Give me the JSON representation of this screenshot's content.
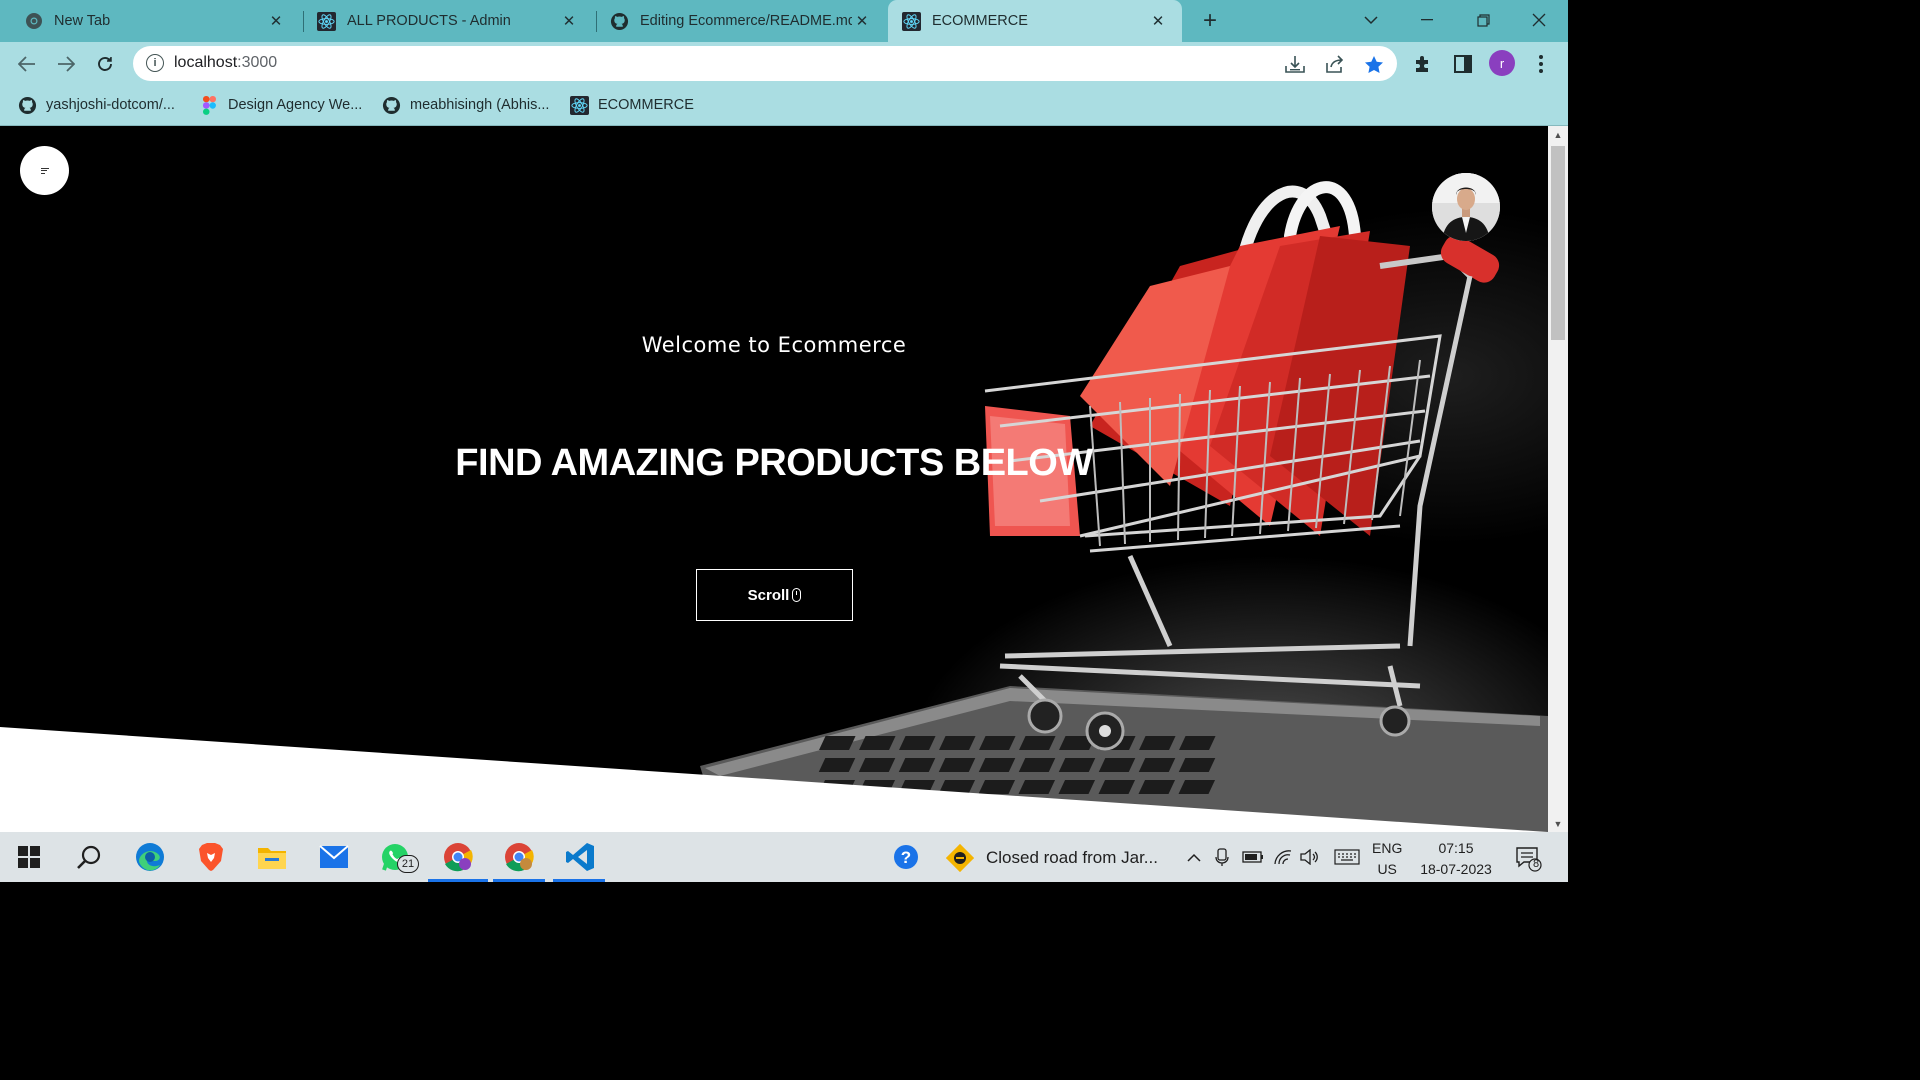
{
  "browser": {
    "tabs": [
      {
        "title": "New Tab",
        "icon": "chrome-icon",
        "active": false
      },
      {
        "title": "ALL PRODUCTS - Admin",
        "icon": "react-icon",
        "active": false
      },
      {
        "title": "Editing Ecommerce/README.md",
        "icon": "github-icon",
        "active": false
      },
      {
        "title": "ECOMMERCE",
        "icon": "react-icon",
        "active": true
      }
    ],
    "url_host": "localhost",
    "url_path": ":3000",
    "profile_initial": "r",
    "bookmarks": [
      {
        "label": "yashjoshi-dotcom/...",
        "icon": "github-icon"
      },
      {
        "label": "Design Agency We...",
        "icon": "figma-icon"
      },
      {
        "label": "meabhisingh (Abhis...",
        "icon": "github-icon"
      },
      {
        "label": "ECOMMERCE",
        "icon": "react-icon"
      }
    ]
  },
  "page": {
    "welcome": "Welcome to Ecommerce",
    "headline": "FIND AMAZING PRODUCTS BELOW",
    "scroll_label": "Scroll"
  },
  "taskbar": {
    "apps": [
      "windows-start-icon",
      "search-icon",
      "edge-icon",
      "brave-icon",
      "file-explorer-icon",
      "mail-icon",
      "whatsapp-icon",
      "chrome-profile-icon",
      "chrome-icon",
      "vscode-icon"
    ],
    "whatsapp_badge": "21",
    "weather_text": "Closed road from Jar...",
    "lang_top": "ENG",
    "lang_bottom": "US",
    "time": "07:15",
    "date": "18-07-2023",
    "notification_count": "8"
  },
  "colors": {
    "tabstrip": "#5eb8c0",
    "toolbar": "#aadde2",
    "accent_star": "#1a73e8",
    "profile": "#8a3fbf",
    "cart_red": "#e8312f"
  }
}
